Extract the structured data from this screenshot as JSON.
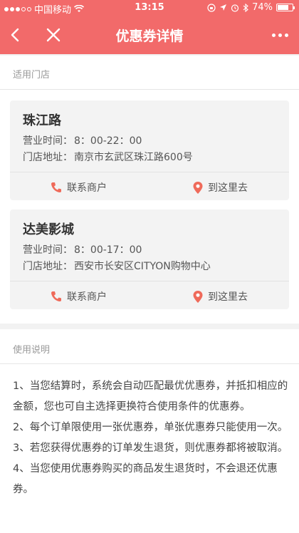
{
  "status_bar": {
    "carrier": "中国移动",
    "time": "13:15",
    "battery": "74%",
    "battery_level": 0.74
  },
  "navbar": {
    "title": "优惠券详情"
  },
  "stores_section": {
    "label": "适用门店",
    "stores": [
      {
        "name": "珠江路",
        "hours_label": "营业时间：",
        "hours": "8：00-22：00",
        "address_label": "门店地址：",
        "address": "南京市玄武区珠江路600号",
        "contact_label": "联系商户",
        "directions_label": "到这里去"
      },
      {
        "name": "达美影城",
        "hours_label": "营业时间：",
        "hours": "8：00-17：00",
        "address_label": "门店地址：",
        "address": "西安市长安区CITYON购物中心",
        "contact_label": "联系商户",
        "directions_label": "到这里去"
      }
    ]
  },
  "usage_section": {
    "label": "使用说明",
    "rules": [
      "1、当您结算时，系统会自动匹配最优优惠券，并抵扣相应的金额，您也可自主选择更换符合使用条件的优惠券。",
      "2、每个订单限使用一张优惠券，单张优惠券只能使用一次。",
      "3、若您获得优惠券的订单发生退货，则优惠券都将被取消。",
      "4、当您使用优惠券购买的商品发生退货时，不会退还优惠券。"
    ]
  },
  "colors": {
    "brand": "#f26a6a",
    "icon_accent": "#ef6a5a"
  }
}
